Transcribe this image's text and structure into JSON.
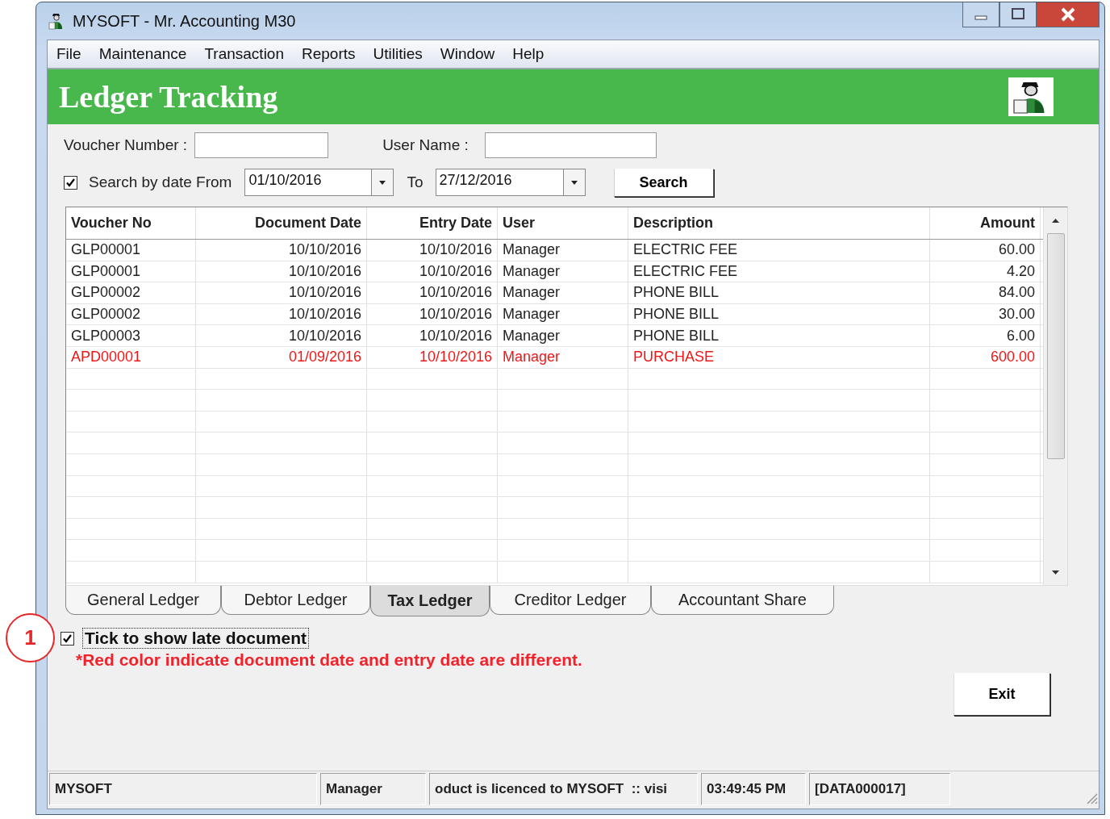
{
  "window": {
    "title": "MYSOFT - Mr. Accounting M30"
  },
  "menu": [
    "File",
    "Maintenance",
    "Transaction",
    "Reports",
    "Utilities",
    "Window",
    "Help"
  ],
  "header": {
    "title": "Ledger Tracking"
  },
  "filters": {
    "voucher_label": "Voucher Number :",
    "user_label": "User Name :",
    "date_filter": {
      "label": "Search by date From",
      "checked": true
    },
    "from": "01/10/2016",
    "to_label": "To",
    "to": "27/12/2016",
    "search_button": "Search"
  },
  "table": {
    "columns": [
      "Voucher No",
      "Document Date",
      "Entry Date",
      "User",
      "Description",
      "Amount"
    ],
    "rows": [
      {
        "cells": [
          "GLP00001",
          "10/10/2016",
          "10/10/2016",
          "Manager",
          "ELECTRIC FEE",
          "60.00"
        ],
        "late": false
      },
      {
        "cells": [
          "GLP00001",
          "10/10/2016",
          "10/10/2016",
          "Manager",
          "ELECTRIC FEE",
          "4.20"
        ],
        "late": false
      },
      {
        "cells": [
          "GLP00002",
          "10/10/2016",
          "10/10/2016",
          "Manager",
          "PHONE BILL",
          "84.00"
        ],
        "late": false
      },
      {
        "cells": [
          "GLP00002",
          "10/10/2016",
          "10/10/2016",
          "Manager",
          "PHONE BILL",
          "30.00"
        ],
        "late": false
      },
      {
        "cells": [
          "GLP00003",
          "10/10/2016",
          "10/10/2016",
          "Manager",
          "PHONE BILL",
          "6.00"
        ],
        "late": false
      },
      {
        "cells": [
          "APD00001",
          "01/09/2016",
          "10/10/2016",
          "Manager",
          "PURCHASE",
          "600.00"
        ],
        "late": true
      }
    ]
  },
  "tabs": [
    {
      "label": "General Ledger",
      "selected": false
    },
    {
      "label": "Debtor Ledger",
      "selected": false
    },
    {
      "label": "Tax Ledger",
      "selected": true
    },
    {
      "label": "Creditor Ledger",
      "selected": false
    },
    {
      "label": "Accountant Share",
      "selected": false
    }
  ],
  "late_option": {
    "label": "Tick to show late document",
    "checked": true
  },
  "note": "*Red color indicate document date and entry date are different.",
  "exit_button": "Exit",
  "status_bar": [
    "MYSOFT",
    "Manager",
    "oduct is licenced to MYSOFT  :: visi",
    "03:49:45 PM",
    "[DATA000017]"
  ],
  "callout": {
    "number": "1"
  }
}
